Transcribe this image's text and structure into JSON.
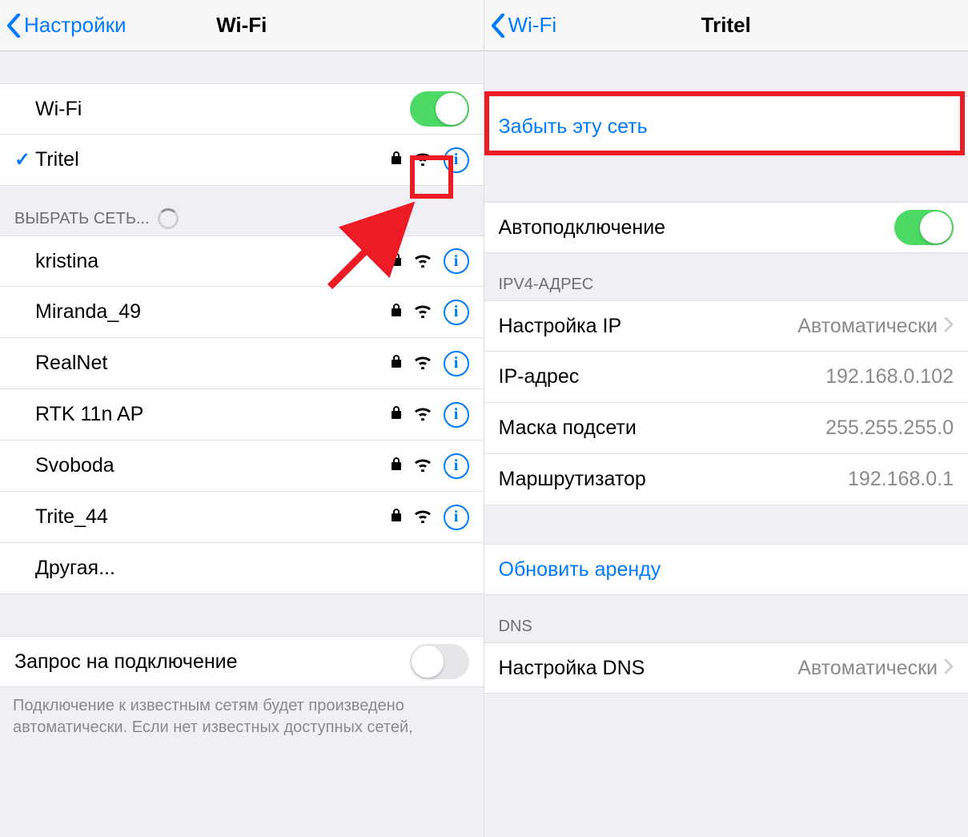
{
  "left": {
    "back_label": "Настройки",
    "title": "Wi-Fi",
    "wifi_toggle_label": "Wi-Fi",
    "connected_network": "Tritel",
    "choose_network_header": "ВЫБРАТЬ СЕТЬ...",
    "networks": [
      {
        "name": "kristina"
      },
      {
        "name": "Miranda_49"
      },
      {
        "name": "RealNet"
      },
      {
        "name": "RTK 11n AP"
      },
      {
        "name": "Svoboda"
      },
      {
        "name": "Trite_44"
      }
    ],
    "other_label": "Другая...",
    "ask_to_join_label": "Запрос на подключение",
    "footer": "Подключение к известным сетям будет произведено автоматически. Если нет известных доступных сетей,"
  },
  "right": {
    "back_label": "Wi-Fi",
    "title": "Tritel",
    "forget_label": "Забыть эту сеть",
    "auto_join_label": "Автоподключение",
    "ipv4_header": "IPV4-АДРЕС",
    "configure_ip_label": "Настройка IP",
    "configure_ip_value": "Автоматически",
    "ip_address_label": "IP-адрес",
    "ip_address_value": "192.168.0.102",
    "subnet_label": "Маска подсети",
    "subnet_value": "255.255.255.0",
    "router_label": "Маршрутизатор",
    "router_value": "192.168.0.1",
    "renew_lease_label": "Обновить аренду",
    "dns_header": "DNS",
    "configure_dns_label": "Настройка DNS",
    "configure_dns_value": "Автоматически"
  },
  "colors": {
    "accent": "#007aff",
    "green": "#4cd964",
    "red": "#ed1c24"
  }
}
